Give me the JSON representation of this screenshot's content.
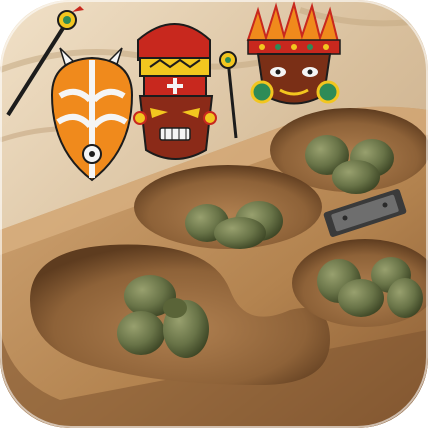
{
  "app_icon": {
    "label": "",
    "scene": "mancala-board-with-tribal-masks",
    "colors": {
      "sand_light": "#e8d5b8",
      "sand_dark": "#b89a78",
      "wood_light": "#c89a67",
      "wood_mid": "#a8784a",
      "wood_dark": "#6b4626",
      "pit_shadow": "#7a5233",
      "stone_green": "#6d7a4a",
      "stone_dark": "#4e5a32",
      "mask_orange": "#f08a1c",
      "mask_red": "#c8281e",
      "mask_yellow": "#f2c61f",
      "mask_white": "#f5f5f5"
    }
  },
  "pits": [
    {
      "name": "store-left",
      "stones": 4
    },
    {
      "name": "pit-top-1",
      "stones": 3
    },
    {
      "name": "pit-top-2",
      "stones": 3
    },
    {
      "name": "pit-bottom-1",
      "stones": 4
    }
  ],
  "masks": [
    {
      "name": "orange-white-mask",
      "style": "orange with white stripes"
    },
    {
      "name": "red-gold-mask",
      "style": "red and gold totem"
    },
    {
      "name": "feathered-mask",
      "style": "orange feather headdress"
    }
  ]
}
